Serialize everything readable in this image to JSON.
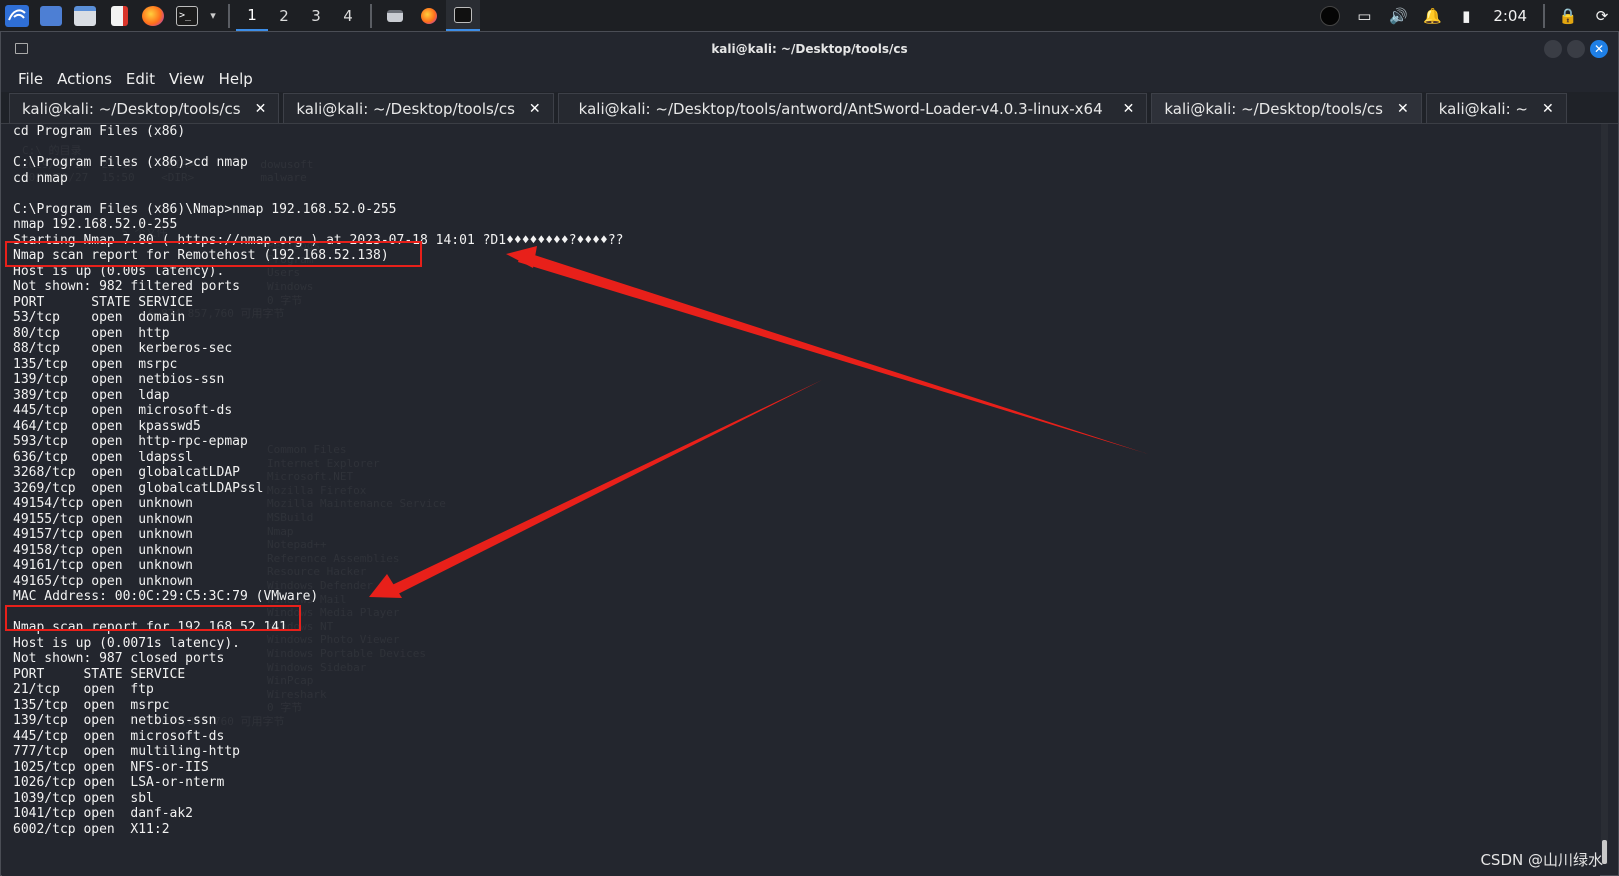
{
  "panel": {
    "workspaces": [
      "1",
      "2",
      "3",
      "4"
    ],
    "clock": "2:04",
    "icons": [
      "kali-menu-icon",
      "desktop-icon",
      "file-manager-icon",
      "text-editor-icon",
      "firefox-icon",
      "terminal-icon",
      "window-task-icon",
      "firefox-task-icon",
      "terminal-task-icon",
      "battery-icon",
      "display-icon",
      "volume-icon",
      "bell-icon",
      "power-plug-icon",
      "lock-icon",
      "refresh-icon"
    ]
  },
  "window": {
    "title": "kali@kali: ~/Desktop/tools/cs"
  },
  "menubar": [
    "File",
    "Actions",
    "Edit",
    "View",
    "Help"
  ],
  "tabs": [
    {
      "label": "kali@kali: ~/Desktop/tools/cs",
      "active": false
    },
    {
      "label": "kali@kali: ~/Desktop/tools/cs",
      "active": false
    },
    {
      "label": "kali@kali: ~/Desktop/tools/antword/AntSword-Loader-v4.0.3-linux-x64",
      "active": false
    },
    {
      "label": "kali@kali: ~/Desktop/tools/cs",
      "active": true
    },
    {
      "label": "kali@kali: ~",
      "active": false
    }
  ],
  "terminal": {
    "lines": [
      "cd Program Files (x86)",
      "",
      "C:\\Program Files (x86)>cd nmap",
      "cd nmap",
      "",
      "C:\\Program Files (x86)\\Nmap>nmap 192.168.52.0-255",
      "nmap 192.168.52.0-255",
      "Starting Nmap 7.80 ( https://nmap.org ) at 2023-07-18 14:01 ?D1♦♦♦♦♦♦♦♦?♦♦♦♦??",
      "Nmap scan report for Remotehost (192.168.52.138)",
      "Host is up (0.00s latency).",
      "Not shown: 982 filtered ports",
      "PORT      STATE SERVICE",
      "53/tcp    open  domain",
      "80/tcp    open  http",
      "88/tcp    open  kerberos-sec",
      "135/tcp   open  msrpc",
      "139/tcp   open  netbios-ssn",
      "389/tcp   open  ldap",
      "445/tcp   open  microsoft-ds",
      "464/tcp   open  kpasswd5",
      "593/tcp   open  http-rpc-epmap",
      "636/tcp   open  ldapssl",
      "3268/tcp  open  globalcatLDAP",
      "3269/tcp  open  globalcatLDAPssl",
      "49154/tcp open  unknown",
      "49155/tcp open  unknown",
      "49157/tcp open  unknown",
      "49158/tcp open  unknown",
      "49161/tcp open  unknown",
      "49165/tcp open  unknown",
      "MAC Address: 00:0C:29:C5:3C:79 (VMware)",
      "",
      "Nmap scan report for 192.168.52.141",
      "Host is up (0.0071s latency).",
      "Not shown: 987 closed ports",
      "PORT     STATE SERVICE",
      "21/tcp   open  ftp",
      "135/tcp  open  msrpc",
      "139/tcp  open  netbios-ssn",
      "445/tcp  open  microsoft-ds",
      "777/tcp  open  multiling-http",
      "1025/tcp open  NFS-or-IIS",
      "1026/tcp open  LSA-or-nterm",
      "1039/tcp open  sbl",
      "1041/tcp open  danf-ak2",
      "6002/tcp open  X11:2"
    ],
    "ghost_text": "C:\\ 的目录\n2019/09/21  23:13    <DIR>          dowusoft\n2019/09/27  15:50    <DIR>          malware\n\n\n\n               5 个文件\n                                     PerfLogs\n                                     Program\n                                     Users\n                                     Windows\n                                     0 字节\n                   6,874,857,760 可用字节\n\n\n\n\n\n\n\n\n\n                                     Common Files\n                                     Internet Explorer\n                                     Microsoft.NET\n                                     Mozilla Firefox\n                                     Mozilla Maintenance Service\n                                     MSBuild\n                                     Nmap\n                                     Notepad++\n                                     Reference Assemblies\n                                     Resource Hacker\n                                     Windows Defender\n                                     Windows Mail\n                                     Windows Media Player\n                                     Windows NT\n                                     Windows Photo Viewer\n                                     Windows Portable Devices\n                                     Windows Sidebar\n                                     WinPcap\n                                     Wireshark\n                                     0 字节\n                   6,874,857,760 可用字节"
  },
  "watermark": "CSDN @山川绿水",
  "colors": {
    "annotation_red": "#e8201a",
    "terminal_bg": "#23262e",
    "accent_blue": "#1e7fe6"
  }
}
